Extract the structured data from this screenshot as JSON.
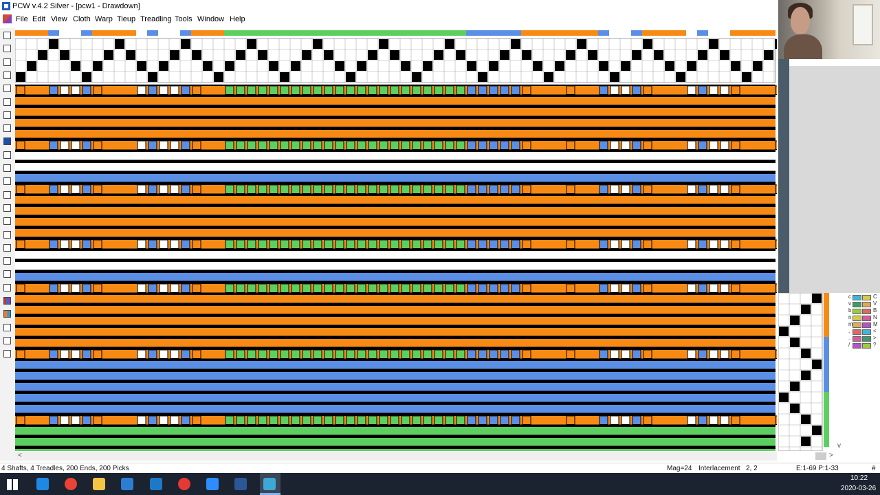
{
  "window": {
    "title": "PCW v.4.2 Silver - [pcw1 - Drawdown]"
  },
  "menu": {
    "items": [
      "File",
      "Edit",
      "View",
      "Cloth",
      "Warp",
      "Tieup",
      "Treadling",
      "Tools",
      "Window",
      "Help"
    ]
  },
  "toolbar": {
    "icons": [
      "new-file-icon",
      "open-folder-icon",
      "save-icon",
      "print-icon",
      "undo-icon",
      "cut-icon",
      "copy-icon",
      "paste-icon",
      "select-icon",
      "rectangle-icon",
      "pencil-icon",
      "draw-line-icon",
      "curve-icon",
      "wave-icon",
      "straight-draw-icon",
      "point-draw-icon",
      "pattern-icon",
      "diamond-icon",
      "gear-icon",
      "lock-icon",
      "color-grid-icon",
      "color-palette-icon",
      "zoom-in-icon",
      "zoom-out-icon",
      "help-pointer-icon"
    ]
  },
  "colors": {
    "orange": "#f78a14",
    "blue": "#5b8fe6",
    "green": "#5dcf60",
    "white": "#ffffff",
    "black": "#000000"
  },
  "palette": {
    "letters_left": [
      "c",
      "v",
      "b",
      "n",
      "m",
      ",",
      ".",
      "/"
    ],
    "letters_right": [
      "C",
      "V",
      "B",
      "N",
      "M",
      "<",
      ">",
      "?"
    ]
  },
  "scrollbar": {
    "left_arrow": "<",
    "right_arrow": ">",
    "down_arrow": "v"
  },
  "status": {
    "summary": "4 Shafts, 4 Treadles, 200 Ends, 200 Picks",
    "magnification": "Mag=24",
    "interlacement": "Interlacement",
    "interlacement_value": "2, 2",
    "position": "E:1-69  P:1-33",
    "hash": "#"
  },
  "taskbar": {
    "icons": [
      "windows-start-icon",
      "edge-icon",
      "chrome-icon",
      "file-explorer-icon",
      "store-icon",
      "mail-icon",
      "opera-icon",
      "zoom-icon",
      "word-icon",
      "pcw-weaving-icon"
    ],
    "time": "10:22",
    "date": "2020-03-26"
  }
}
